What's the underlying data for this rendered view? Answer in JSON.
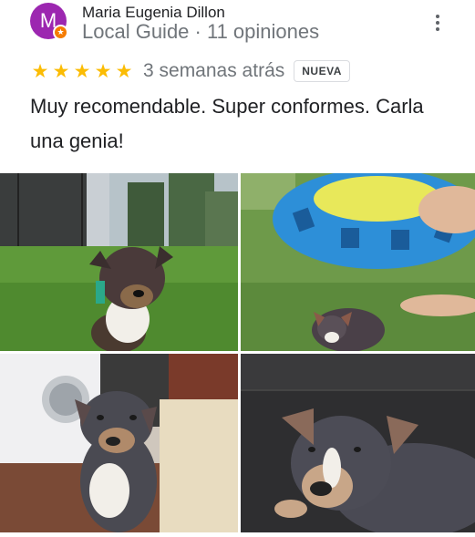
{
  "review": {
    "author": {
      "initial": "M",
      "name": "Maria Eugenia Dillon",
      "meta": "Local Guide · 11 opiniones"
    },
    "rating": 5,
    "rating_stars": [
      "★",
      "★",
      "★",
      "★",
      "★"
    ],
    "date": "3 semanas atrás",
    "badge": "NUEVA",
    "text": "Muy recomendable. Super conformes. Carla una genia!",
    "photo_count": 4
  },
  "colors": {
    "avatar": "#9c27b0",
    "local_guide_badge": "#f57c00",
    "star": "#fbbc04",
    "secondary_text": "#70757a"
  },
  "icons": {
    "more": "more-vert-icon",
    "local_guide": "local-guide-badge-icon",
    "star": "star-icon"
  }
}
